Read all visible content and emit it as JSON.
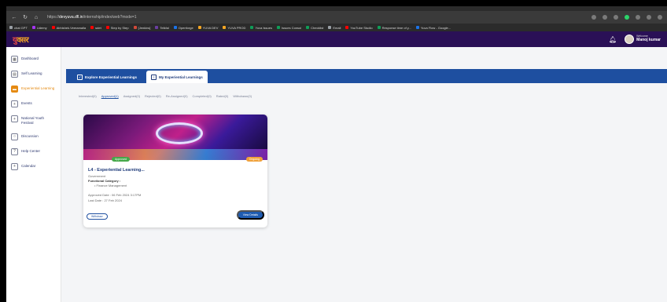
{
  "browser": {
    "url_prefix": "https://",
    "url_domain": "devyuva.dfl.in",
    "url_path": "/internship/index/web?mode=1",
    "bookmarks": [
      {
        "label": "chat GPT",
        "color": "#9aa0a6"
      },
      {
        "label": "Udemy",
        "color": "#a435f0"
      },
      {
        "label": "Abhishek.Veeramalla",
        "color": "#ff0000"
      },
      {
        "label": "sdet",
        "color": "#ff0000"
      },
      {
        "label": "Step by Step",
        "color": "#ff0000"
      },
      {
        "label": "[Jenkins]",
        "color": "#d24939"
      },
      {
        "label": "Telkfal",
        "color": "#6a3ea1"
      },
      {
        "label": "Openforge",
        "color": "#1a73e8"
      },
      {
        "label": "YUVA DEV",
        "color": "#f5a623"
      },
      {
        "label": "YUVA PROD",
        "color": "#f5a623"
      },
      {
        "label": "Yuva Issues",
        "color": "#0f9d58"
      },
      {
        "label": "Issues Consoi",
        "color": "#0f9d58"
      },
      {
        "label": "Checklist",
        "color": "#0f9d58"
      },
      {
        "label": "Email",
        "color": "#9aa0a6"
      },
      {
        "label": "YouTube Studio",
        "color": "#ff0000"
      },
      {
        "label": "Response time of y...",
        "color": "#0f9d58"
      },
      {
        "label": "Yuva Flow - Google...",
        "color": "#1a73e8"
      }
    ]
  },
  "header": {
    "logo_a": "यु",
    "logo_b": "वसर",
    "welcome": "Welcome",
    "user_name": "Manoj kumar"
  },
  "sidebar": {
    "items": [
      {
        "label": "Dashboard",
        "icon": "dashboard-icon",
        "glyph": "▦"
      },
      {
        "label": "Self Learning",
        "icon": "book-icon",
        "glyph": "▤"
      },
      {
        "label": "Experiential Learning",
        "icon": "briefcase-icon",
        "glyph": "▬"
      },
      {
        "label": "Events",
        "icon": "event-icon",
        "glyph": "+"
      },
      {
        "label": "National Youth Festival",
        "icon": "festival-icon",
        "glyph": "+"
      },
      {
        "label": "Discussion",
        "icon": "chat-icon",
        "glyph": "○"
      },
      {
        "label": "Help Center",
        "icon": "help-icon",
        "glyph": "?"
      },
      {
        "label": "Calendar",
        "icon": "calendar-icon",
        "glyph": "+"
      }
    ],
    "active_index": 2
  },
  "tabs": {
    "explore": "Explore Experiential Learnings",
    "mine": "My Experiential Learnings"
  },
  "filters": [
    "Interested(0)",
    "Approved(1)",
    "Assigned(0)",
    "Rejected(0)",
    "Re-Assigned(0)",
    "Completed(0)",
    "Rated(0)",
    "Withdrawn(0)"
  ],
  "filter_active_index": 1,
  "card": {
    "badge_left": "Approved",
    "badge_right": "Ongoing",
    "title": "L4 - Experiential Learning...",
    "org": "Government",
    "category_label": "Functional Category :",
    "category_value": "Finance Management",
    "approved_date": "Approved Date : 06 Feb 2024 3:17PM",
    "last_date": "Last Date : 27 Feb 2024",
    "withdraw": "Withdraw",
    "view": "View Details"
  },
  "colors": {
    "header_bg": "#2a1056",
    "tab_bar": "#1e4fa0",
    "accent_orange": "#e58a12"
  }
}
